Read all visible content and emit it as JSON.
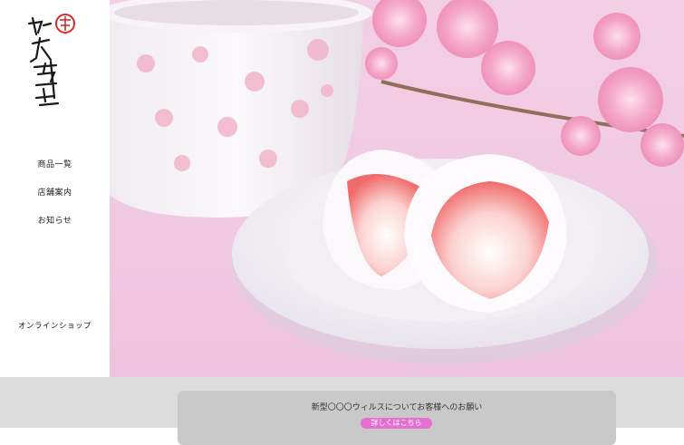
{
  "brand": {
    "logo_text": "和菓子 果空堂",
    "accent_color": "#d42a2a"
  },
  "nav": {
    "items": [
      {
        "label": "商品一覧"
      },
      {
        "label": "店舗案内"
      },
      {
        "label": "お知らせ"
      }
    ],
    "shop_label": "オンラインショップ"
  },
  "hero": {
    "image": "strawberry-daifuku-on-plate-with-sakura-bowl"
  },
  "notice": {
    "text": "新型〇〇〇ウィルスについてお客様へのお願い",
    "button_label": "詳しくはこちら",
    "button_color": "#e66fd2"
  }
}
